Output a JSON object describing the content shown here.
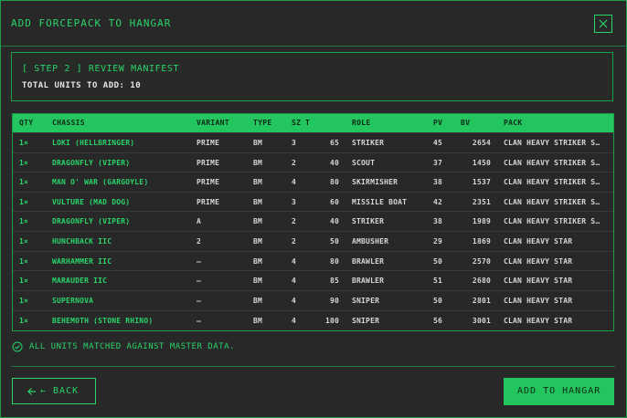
{
  "dialog": {
    "title": "ADD FORCEPACK TO HANGAR",
    "close_icon": "close-icon"
  },
  "step": {
    "title": "[ STEP 2 ] REVIEW MANIFEST",
    "total_label": "TOTAL UNITS TO ADD: 10"
  },
  "table": {
    "headers": {
      "qty": "QTY",
      "chassis": "CHASSIS",
      "variant": "VARIANT",
      "type": "TYPE",
      "sz": "SZ",
      "t": "T",
      "role": "ROLE",
      "pv": "PV",
      "bv": "BV",
      "pack": "PACK"
    },
    "rows": [
      {
        "qty": "1×",
        "chassis": "LOKI (HELLBRINGER)",
        "variant": "PRIME",
        "type": "BM",
        "sz": "3",
        "t": "65",
        "role": "STRIKER",
        "pv": "45",
        "bv": "2654",
        "pack": "CLAN HEAVY STRIKER S…"
      },
      {
        "qty": "1×",
        "chassis": "DRAGONFLY (VIPER)",
        "variant": "PRIME",
        "type": "BM",
        "sz": "2",
        "t": "40",
        "role": "SCOUT",
        "pv": "37",
        "bv": "1450",
        "pack": "CLAN HEAVY STRIKER S…"
      },
      {
        "qty": "1×",
        "chassis": "MAN O' WAR (GARGOYLE)",
        "variant": "PRIME",
        "type": "BM",
        "sz": "4",
        "t": "80",
        "role": "SKIRMISHER",
        "pv": "38",
        "bv": "1537",
        "pack": "CLAN HEAVY STRIKER S…"
      },
      {
        "qty": "1×",
        "chassis": "VULTURE (MAD DOG)",
        "variant": "PRIME",
        "type": "BM",
        "sz": "3",
        "t": "60",
        "role": "MISSILE BOAT",
        "pv": "42",
        "bv": "2351",
        "pack": "CLAN HEAVY STRIKER S…"
      },
      {
        "qty": "1×",
        "chassis": "DRAGONFLY (VIPER)",
        "variant": "A",
        "type": "BM",
        "sz": "2",
        "t": "40",
        "role": "STRIKER",
        "pv": "38",
        "bv": "1989",
        "pack": "CLAN HEAVY STRIKER S…"
      },
      {
        "qty": "1×",
        "chassis": "HUNCHBACK IIC",
        "variant": "2",
        "type": "BM",
        "sz": "2",
        "t": "50",
        "role": "AMBUSHER",
        "pv": "29",
        "bv": "1869",
        "pack": "CLAN HEAVY STAR"
      },
      {
        "qty": "1×",
        "chassis": "WARHAMMER IIC",
        "variant": "—",
        "type": "BM",
        "sz": "4",
        "t": "80",
        "role": "BRAWLER",
        "pv": "50",
        "bv": "2570",
        "pack": "CLAN HEAVY STAR"
      },
      {
        "qty": "1×",
        "chassis": "MARAUDER IIC",
        "variant": "—",
        "type": "BM",
        "sz": "4",
        "t": "85",
        "role": "BRAWLER",
        "pv": "51",
        "bv": "2680",
        "pack": "CLAN HEAVY STAR"
      },
      {
        "qty": "1×",
        "chassis": "SUPERNOVA",
        "variant": "—",
        "type": "BM",
        "sz": "4",
        "t": "90",
        "role": "SNIPER",
        "pv": "50",
        "bv": "2801",
        "pack": "CLAN HEAVY STAR"
      },
      {
        "qty": "1×",
        "chassis": "BEHEMOTH (STONE RHINO)",
        "variant": "—",
        "type": "BM",
        "sz": "4",
        "t": "100",
        "role": "SNIPER",
        "pv": "56",
        "bv": "3001",
        "pack": "CLAN HEAVY STAR"
      }
    ]
  },
  "status": {
    "icon": "check-circle-icon",
    "text": "ALL UNITS MATCHED AGAINST MASTER DATA."
  },
  "footer": {
    "back_label": "← BACK",
    "back_icon": "arrow-left-icon",
    "add_label": "ADD TO HANGAR"
  },
  "colors": {
    "accent": "#22c55e",
    "background": "#282828"
  }
}
